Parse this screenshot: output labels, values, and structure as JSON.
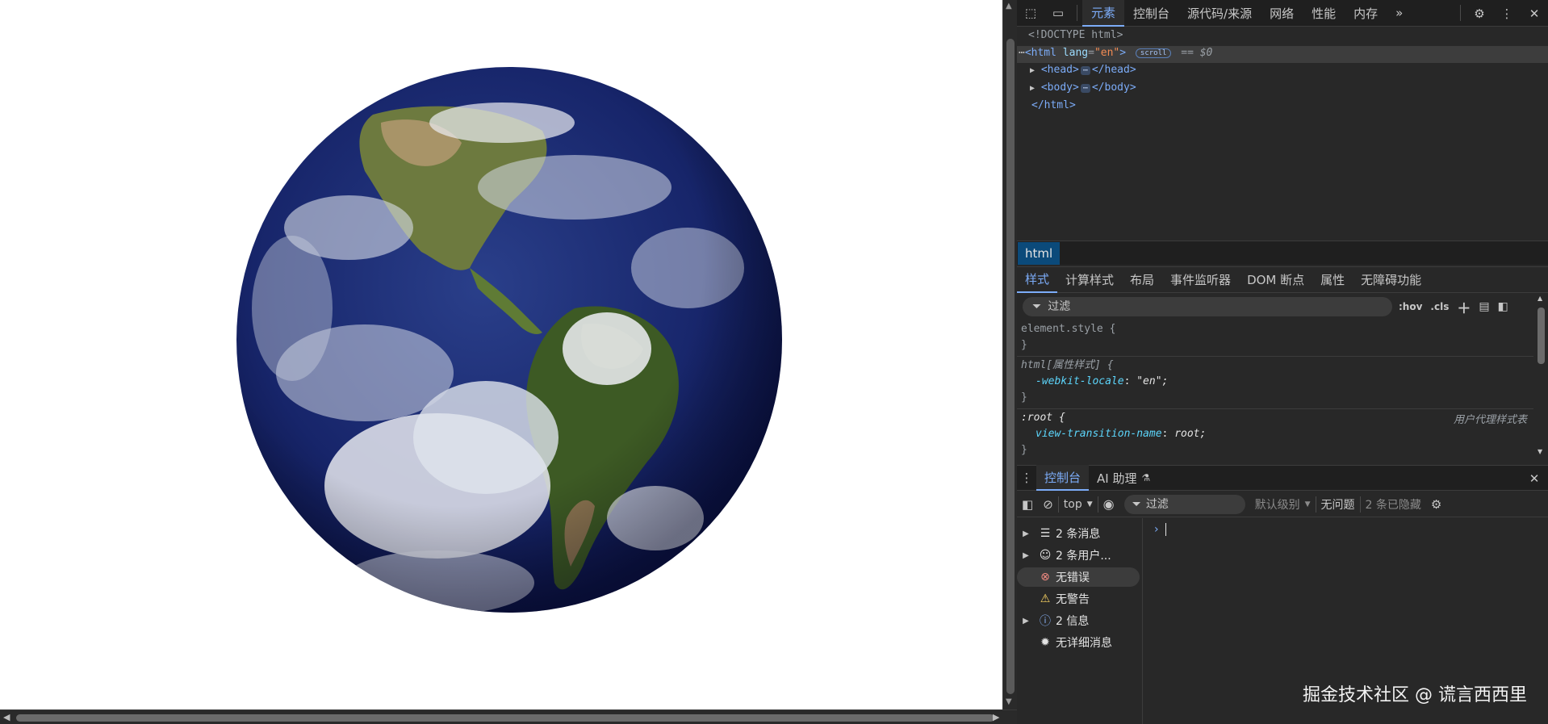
{
  "devtools": {
    "tabs": [
      "元素",
      "控制台",
      "源代码/来源",
      "网络",
      "性能",
      "内存"
    ],
    "overflow": "»",
    "elements": {
      "doctype": "<!DOCTYPE html>",
      "html_open_tag": "<html",
      "html_lang_attr": "lang",
      "html_lang_value": "\"en\"",
      "html_gt": ">",
      "scroll_badge": "scroll",
      "selected_marker": "== $0",
      "head_open": "<head>",
      "head_close": "</head>",
      "body_open": "<body>",
      "body_close": "</body>",
      "html_close": "</html>",
      "ellipsis": "⋯"
    },
    "breadcrumb": "html",
    "style_tabs": [
      "样式",
      "计算样式",
      "布局",
      "事件监听器",
      "DOM 断点",
      "属性",
      "无障碍功能"
    ],
    "styles_filter_placeholder": "过滤",
    "styles_tools": [
      ":hov",
      ".cls"
    ],
    "rules": {
      "element_style": "element.style {",
      "close": "}",
      "html_attr_sel": "html[属性样式] {",
      "html_attr_prop": "-webkit-locale",
      "html_attr_val": "\"en\";",
      "root_sel": ":root {",
      "root_prop": "view-transition-name",
      "root_val": "root;",
      "ua_label": "用户代理样式表"
    },
    "drawer_tabs": [
      "控制台",
      "AI 助理"
    ],
    "console": {
      "context": "top",
      "filter_placeholder": "过滤",
      "level": "默认级别",
      "issues": "无问题",
      "hidden": "2 条已隐藏",
      "prompt": "›"
    },
    "sidebar_items": [
      {
        "label": "2 条消息",
        "icon": "list-icon"
      },
      {
        "label": "2 条用户...",
        "icon": "user-icon"
      },
      {
        "label": "无错误",
        "icon": "error-icon"
      },
      {
        "label": "无警告",
        "icon": "warning-icon"
      },
      {
        "label": "2 信息",
        "icon": "info-icon"
      },
      {
        "label": "无详细消息",
        "icon": "bug-icon"
      }
    ]
  },
  "watermark": "掘金技术社区 @ 谎言西西里",
  "colors": {
    "accent": "#7cacf8",
    "breadcrumb_bg": "#0b4a7a",
    "panel_bg": "#282828"
  }
}
